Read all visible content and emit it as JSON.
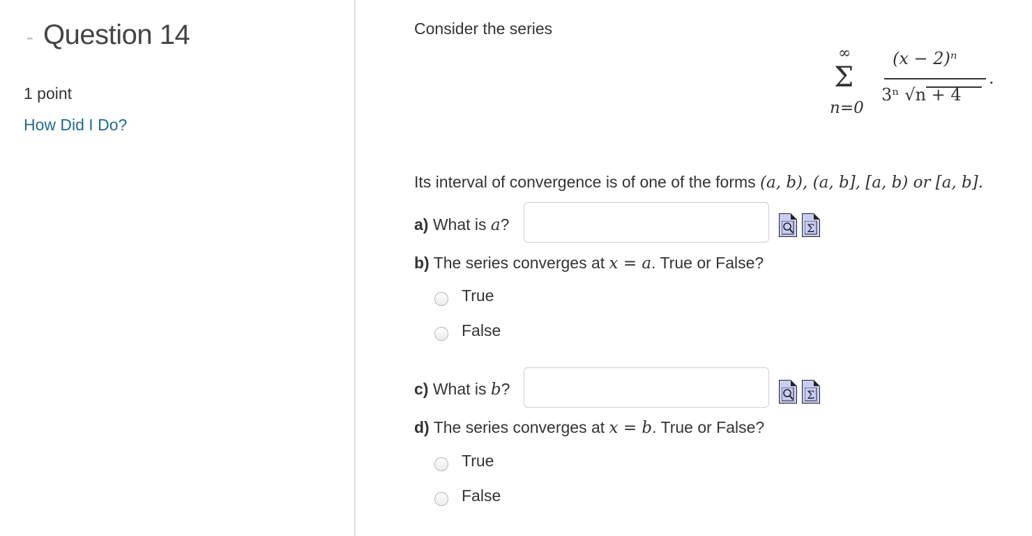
{
  "sidebar": {
    "dash": "-",
    "title": "Question 14",
    "points": "1 point",
    "how_link": "How Did I Do?"
  },
  "problem": {
    "intro": "Consider the series",
    "series": {
      "sum_top": "∞",
      "sum_symbol": "Σ",
      "sum_bottom": "n=0",
      "numerator": "(x − 2)ⁿ",
      "denominator": "3ⁿ √n + 4",
      "end": "."
    },
    "interval_text": "Its interval of convergence is of one of the forms",
    "interval_forms": "(a, b), (a, b], [a, b) or [a, b].",
    "part_a": {
      "label": "a)",
      "text": "What is",
      "var": "a",
      "q": "?",
      "value": ""
    },
    "part_b": {
      "label": "b)",
      "text_before": "The series converges at",
      "math": "x = a",
      "text_after": ". True or False?",
      "options": [
        "True",
        "False"
      ]
    },
    "part_c": {
      "label": "c)",
      "text": "What is",
      "var": "b",
      "q": "?",
      "value": ""
    },
    "part_d": {
      "label": "d)",
      "text_before": "The series converges at",
      "math": "x = b",
      "text_after": ". True or False?",
      "options": [
        "True",
        "False"
      ]
    }
  },
  "icons": [
    "preview-icon",
    "equation-icon"
  ]
}
